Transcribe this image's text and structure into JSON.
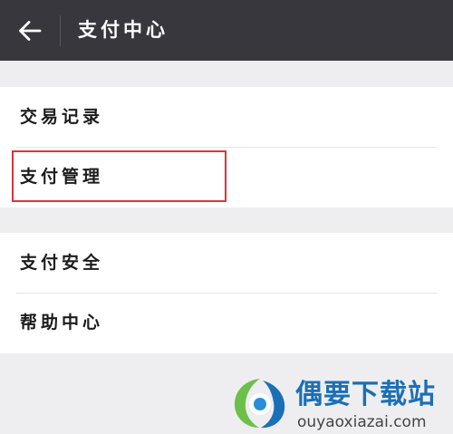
{
  "header": {
    "title": "支付中心",
    "back_icon": "arrow-left-icon"
  },
  "groups": [
    {
      "items": [
        {
          "label": "交易记录"
        },
        {
          "label": "支付管理",
          "highlighted": true
        }
      ]
    },
    {
      "items": [
        {
          "label": "支付安全"
        },
        {
          "label": "帮助中心"
        }
      ]
    }
  ],
  "watermark": {
    "title": "偶要下载站",
    "url": "ouyaoxiazai.com"
  },
  "colors": {
    "header_bg": "#38373d",
    "page_bg": "#eeeef0",
    "highlight": "#e0323a",
    "watermark_blue": "#1b6fb6",
    "watermark_green": "#6cc04a"
  }
}
